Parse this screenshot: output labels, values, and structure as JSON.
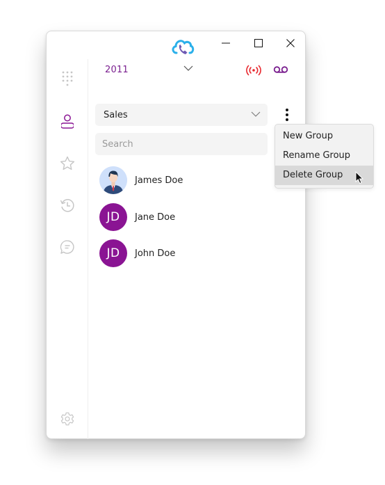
{
  "window": {
    "controls": {
      "minimize": "minimize",
      "maximize": "maximize",
      "close": "close"
    },
    "logo_icon": "cloud-phone-icon"
  },
  "header": {
    "extension": "2011",
    "status_icon": "broadcast-icon",
    "voicemail_icon": "voicemail-icon",
    "colors": {
      "status": "#e8262d",
      "accent": "#7a1f8f"
    }
  },
  "sidebar": {
    "items": [
      {
        "name": "dialpad",
        "icon": "dialpad-icon",
        "active": false
      },
      {
        "name": "contacts",
        "icon": "contacts-icon",
        "active": true
      },
      {
        "name": "favorites",
        "icon": "star-icon",
        "active": false
      },
      {
        "name": "history",
        "icon": "history-icon",
        "active": false
      },
      {
        "name": "chat",
        "icon": "chat-icon",
        "active": false
      }
    ],
    "settings_icon": "gear-icon"
  },
  "contacts": {
    "group": {
      "selected": "Sales"
    },
    "search": {
      "placeholder": "Search",
      "value": ""
    },
    "list": [
      {
        "name": "James Doe",
        "avatar": "photo"
      },
      {
        "name": "Jane Doe",
        "avatar": "initials",
        "initials": "JD"
      },
      {
        "name": "John Doe",
        "avatar": "initials",
        "initials": "JD"
      }
    ]
  },
  "group_menu": {
    "items": [
      {
        "label": "New Group",
        "hovered": false
      },
      {
        "label": "Rename Group",
        "hovered": false
      },
      {
        "label": "Delete Group",
        "hovered": true
      }
    ]
  }
}
